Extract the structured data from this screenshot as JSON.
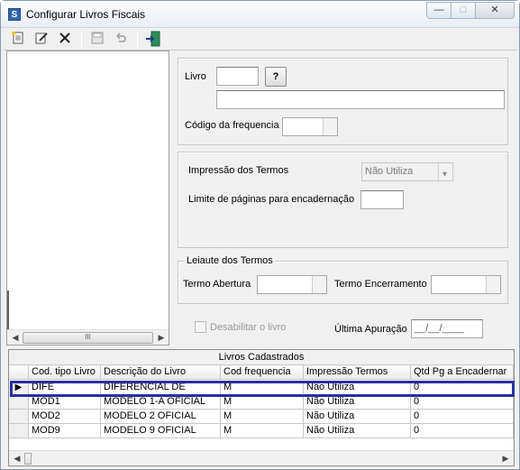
{
  "window": {
    "title": "Configurar Livros Fiscais",
    "min": "—",
    "max": "□",
    "close": "✕"
  },
  "livro": {
    "label": "Livro",
    "value": "",
    "lookup_label": "?",
    "description": ""
  },
  "frequencia": {
    "label": "Código da frequencia",
    "value": ""
  },
  "termos": {
    "impressao_label": "Impressão dos Termos",
    "impressao_value": "Não Utiliza",
    "limite_label": "Limite de páginas para encadernação",
    "limite_value": ""
  },
  "leiaute": {
    "legend": "Leiaute dos Termos",
    "abertura_label": "Termo Abertura",
    "abertura_value": "",
    "encerramento_label": "Termo Encerramento",
    "encerramento_value": ""
  },
  "footer": {
    "desabilitar_label": "Desabilitar o livro",
    "ultima_apuracao_label": "Última Apuração",
    "ultima_apuracao_value": "__/__/____"
  },
  "grid": {
    "caption": "Livros Cadastrados",
    "columns": [
      "Cod. tipo Livro",
      "Descrição do Livro",
      "Cod frequencia",
      "Impressão Termos",
      "Qtd Pg a Encadernar"
    ],
    "rows": [
      {
        "selected": true,
        "cells": [
          "DIFE",
          "DIFERENCIAL DE",
          "M",
          "Não Utiliza",
          "0"
        ]
      },
      {
        "selected": false,
        "cells": [
          "MOD1",
          "MODELO 1-A OFICIAL",
          "M",
          "Não Utiliza",
          "0"
        ]
      },
      {
        "selected": false,
        "cells": [
          "MOD2",
          "MODELO 2 OFICIAL",
          "M",
          "Não Utiliza",
          "0"
        ]
      },
      {
        "selected": false,
        "cells": [
          "MOD9",
          "MODELO 9 OFICIAL",
          "M",
          "Não Utiliza",
          "0"
        ]
      }
    ]
  },
  "icons": {
    "row_indicator": "▶",
    "scroll_left": "◀",
    "scroll_right": "▶",
    "thumb_grip": "III"
  },
  "colors": {
    "selection_outline": "#2a2fa0",
    "app_icon": "#2f67ad"
  }
}
